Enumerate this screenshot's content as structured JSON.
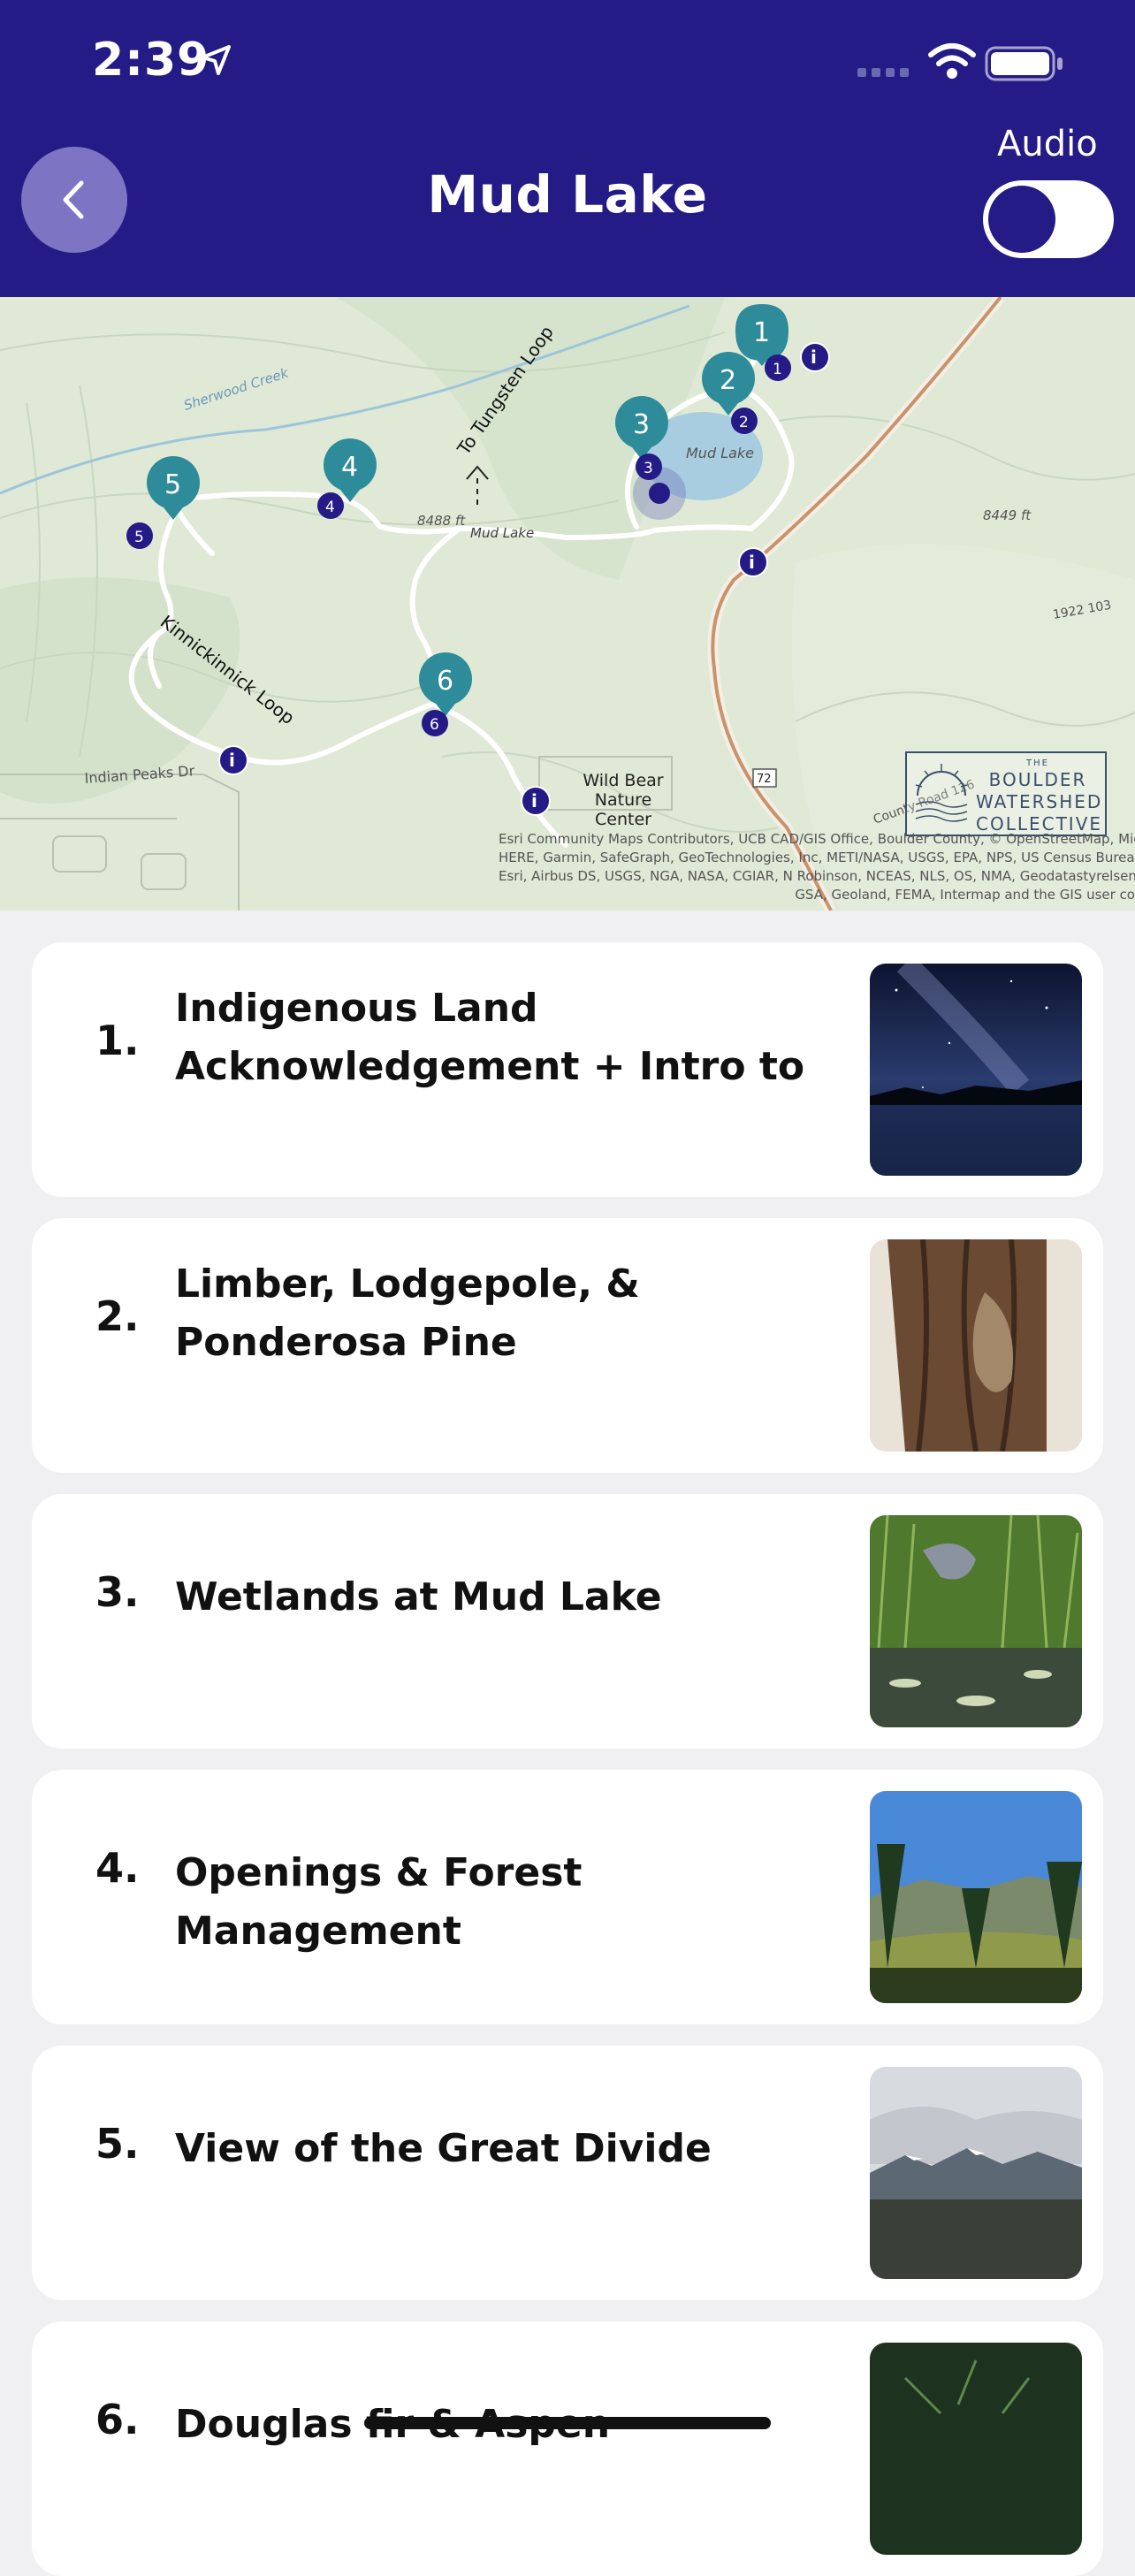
{
  "status_bar": {
    "time": "2:39"
  },
  "header": {
    "title": "Mud Lake",
    "audio_label": "Audio",
    "audio_on": false
  },
  "map": {
    "labels": {
      "sherwood": "Sherwood Creek",
      "tungsten": "To Tungsten Loop",
      "kinnickinnick": "Kinnickinnick Loop",
      "indian_peaks": "Indian Peaks Dr",
      "mud_lake_trail": "Mud Lake",
      "mud_lake_water": "Mud Lake",
      "elev_8488": "8488 ft",
      "elev_8449": "8449 ft",
      "route_72": "72",
      "county_road": "County Road 126",
      "num_1922": "1922 103",
      "wild_bear": "Wild Bear Nature Center"
    },
    "markers": [
      "1",
      "2",
      "3",
      "4",
      "5",
      "6"
    ],
    "logo": {
      "line1": "BOULDER",
      "line2": "WATERSHED",
      "line3": "COLLECTIVE",
      "small": "THE"
    },
    "attribution": [
      "Esri Community Maps Contributors, UCB CAD/GIS Office, Boulder County, © OpenStreetMap, Micros",
      "HERE, Garmin, SafeGraph, GeoTechnologies, Inc, METI/NASA, USGS, EPA, NPS, US Census Bureau, USDA,",
      "Esri, Airbus DS, USGS, NGA, NASA, CGIAR, N Robinson, NCEAS, NLS, OS, NMA, Geodatastyrelsen, Rijkswa",
      "GSA, Geoland, FEMA, Intermap and the GIS user co"
    ]
  },
  "stops": [
    {
      "num": "1.",
      "title": "Indigenous Land Acknowledgement + Intro to",
      "thumb": "night-sky-lake-photo"
    },
    {
      "num": "2.",
      "title": "Limber, Lodgepole, & Ponderosa Pine",
      "thumb": "tree-bark-photo"
    },
    {
      "num": "3.",
      "title": "Wetlands at Mud Lake",
      "thumb": "heron-wetland-photo"
    },
    {
      "num": "4.",
      "title": "Openings & Forest Management",
      "thumb": "forest-meadow-photo"
    },
    {
      "num": "5.",
      "title": "View of the Great Divide",
      "thumb": "mountain-view-photo"
    },
    {
      "num": "6.",
      "title": "Douglas fir & Aspen",
      "thumb": "pine-needles-photo"
    }
  ]
}
